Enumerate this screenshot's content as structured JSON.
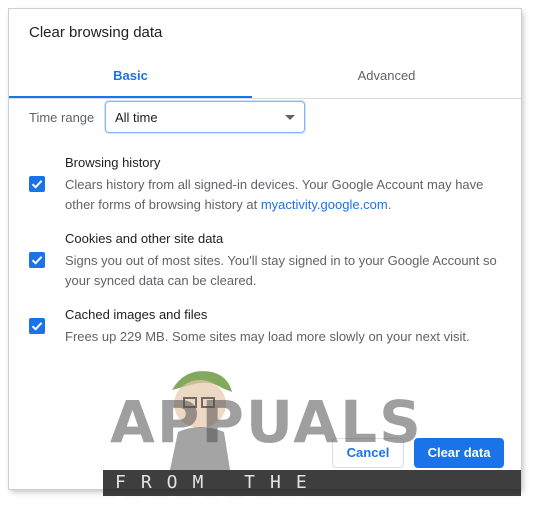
{
  "dialog": {
    "title": "Clear browsing data",
    "tabs": [
      {
        "label": "Basic",
        "active": true
      },
      {
        "label": "Advanced",
        "active": false
      }
    ],
    "time_range": {
      "label": "Time range",
      "value": "All time"
    },
    "options": [
      {
        "title": "Browsing history",
        "description": "Clears history from all signed-in devices. Your Google Account may have other forms of browsing history at",
        "link": "myactivity.google.com",
        "suffix": ".",
        "checked": true
      },
      {
        "title": "Cookies and other site data",
        "description": "Signs you out of most sites. You'll stay signed in to your Google Account so your synced data can be cleared.",
        "checked": true
      },
      {
        "title": "Cached images and files",
        "description": "Frees up 229 MB. Some sites may load more slowly on your next visit.",
        "checked": true
      }
    ],
    "buttons": {
      "cancel": "Cancel",
      "clear": "Clear data"
    },
    "accent_color": "#1a73e8"
  },
  "watermark": {
    "brand": "APPUALS",
    "tagline": "FROM THE EXPERTS!"
  }
}
